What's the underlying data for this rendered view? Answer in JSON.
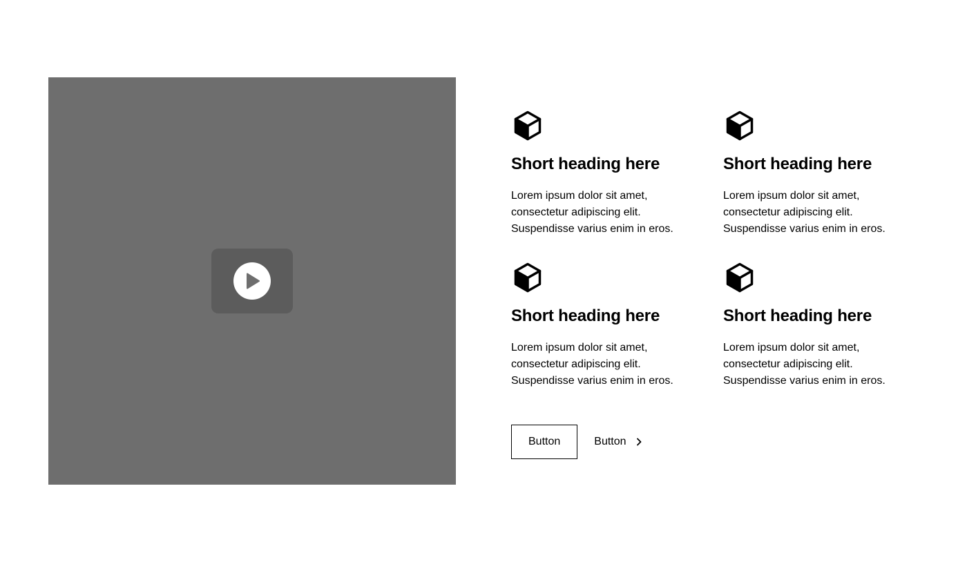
{
  "colors": {
    "video_bg": "#6e6e6e",
    "play_box": "#5c5c5c",
    "play_circle": "#ffffff",
    "text": "#000000"
  },
  "video": {
    "play_icon": "play-icon"
  },
  "features": [
    {
      "icon": "cube-icon",
      "heading": "Short heading here",
      "text": "Lorem ipsum dolor sit amet, consectetur adipiscing elit. Suspendisse varius enim in eros."
    },
    {
      "icon": "cube-icon",
      "heading": "Short heading here",
      "text": "Lorem ipsum dolor sit amet, consectetur adipiscing elit. Suspendisse varius enim in eros."
    },
    {
      "icon": "cube-icon",
      "heading": "Short heading here",
      "text": "Lorem ipsum dolor sit amet, consectetur adipiscing elit. Suspendisse varius enim in eros."
    },
    {
      "icon": "cube-icon",
      "heading": "Short heading here",
      "text": "Lorem ipsum dolor sit amet, consectetur adipiscing elit. Suspendisse varius enim in eros."
    }
  ],
  "actions": {
    "primary_label": "Button",
    "secondary_label": "Button",
    "secondary_icon": "chevron-right-icon"
  }
}
